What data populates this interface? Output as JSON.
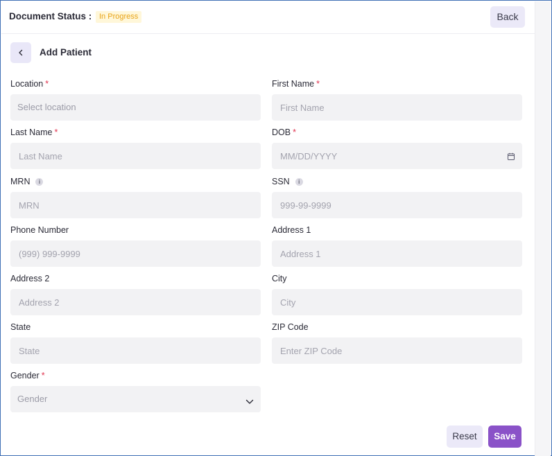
{
  "header": {
    "doc_status_label": "Document Status :",
    "status_badge": "In Progress",
    "back_label": "Back"
  },
  "subheader": {
    "title": "Add Patient",
    "chevron_icon": "chevron-left-icon"
  },
  "fields": {
    "location": {
      "label": "Location",
      "required": "*",
      "placeholder": "Select location"
    },
    "first_name": {
      "label": "First Name",
      "required": "*",
      "placeholder": "First Name"
    },
    "last_name": {
      "label": "Last Name",
      "required": "*",
      "placeholder": "Last Name"
    },
    "dob": {
      "label": "DOB",
      "required": "*",
      "placeholder": "MM/DD/YYYY",
      "icon": "calendar-icon"
    },
    "mrn": {
      "label": "MRN",
      "info": "i",
      "placeholder": "MRN"
    },
    "ssn": {
      "label": "SSN",
      "info": "i",
      "placeholder": "999-99-9999"
    },
    "phone": {
      "label": "Phone Number",
      "placeholder": "(999) 999-9999"
    },
    "address1": {
      "label": "Address 1",
      "placeholder": "Address 1"
    },
    "address2": {
      "label": "Address 2",
      "placeholder": "Address 2"
    },
    "city": {
      "label": "City",
      "placeholder": "City"
    },
    "state": {
      "label": "State",
      "placeholder": "State"
    },
    "zip": {
      "label": "ZIP Code",
      "placeholder": "Enter ZIP Code"
    },
    "gender": {
      "label": "Gender",
      "required": "*",
      "selected": "Gender",
      "icon": "chevron-down-icon"
    }
  },
  "actions": {
    "reset_label": "Reset",
    "save_label": "Save"
  },
  "colors": {
    "accent": "#8a52c8",
    "required": "#e0344f",
    "badge_bg": "#fff7d9",
    "badge_text": "#e8a317",
    "input_bg": "#f2f2f4",
    "secondary_btn_bg": "#ebe9f8"
  }
}
